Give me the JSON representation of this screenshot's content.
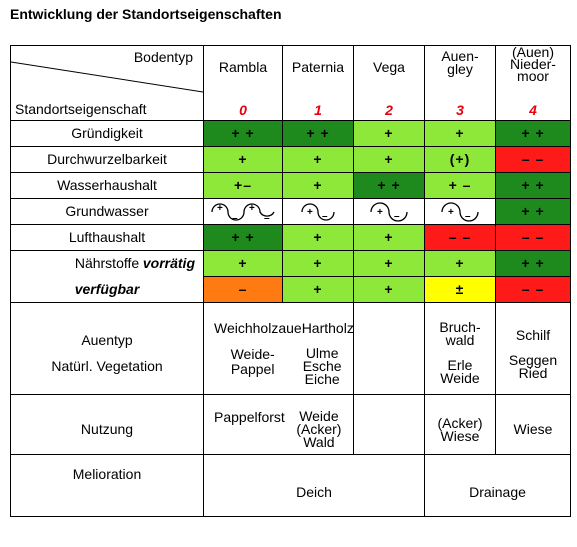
{
  "title": "Entwicklung der Standortseigenschaften",
  "header": {
    "bodentyp": "Bodentyp",
    "standortseigenschaft": "Standortseigenschaft",
    "columns": [
      {
        "name": "Rambla",
        "num": "0"
      },
      {
        "name": "Paternia",
        "num": "1"
      },
      {
        "name": "Vega",
        "num": "2"
      },
      {
        "name": "Auen-\ngley",
        "num": "3"
      },
      {
        "name": "(Auen)\nNieder-\nmoor",
        "num": "4"
      }
    ]
  },
  "rows": [
    {
      "label": "Gründigkeit",
      "cells": [
        "+ +",
        "+ +",
        "+",
        "+",
        "+ +"
      ]
    },
    {
      "label": "Durchwurzelbarkeit",
      "cells": [
        "+",
        "+",
        "+",
        "(+)",
        "– –"
      ]
    },
    {
      "label": "Wasserhaushalt",
      "cells": [
        "+–",
        "+",
        "+ +",
        "+ –",
        "+ +"
      ]
    },
    {
      "label": "Grundwasser",
      "cells": [
        "",
        "",
        "",
        "",
        "+ +"
      ]
    },
    {
      "label": "Lufthaushalt",
      "cells": [
        "+ +",
        "+",
        "+",
        "– –",
        "– –"
      ]
    },
    {
      "label": "Nährstoffe",
      "sub1": "vorrätig",
      "sub2": "verfügbar",
      "cells1": [
        "+",
        "+",
        "+",
        "+",
        "+ +"
      ],
      "cells2": [
        "–",
        "+",
        "+",
        "±",
        "– –"
      ]
    }
  ],
  "colors": {
    "dark_green": "#1e8a1e",
    "light_green": "#8ee83a",
    "red": "#ff1a1a",
    "orange": "#ff7a10",
    "yellow": "#ffff00",
    "number_red": "#e8000f"
  },
  "lower": {
    "auentyp_label": "Auentyp",
    "vegetation_label": "Natürl. Vegetation",
    "auentyp_weich": "Weichholzaue",
    "auentyp_hart": "Hartholzaue",
    "auentyp_bruch": "Bruch-\nwald",
    "auentyp_schilf": "Schilf",
    "veg_weide_pappel": "Weide-Pappel",
    "veg_ulme": "Ulme\nEsche\nEiche",
    "veg_erle": "Erle\nWeide",
    "veg_seggen": "Seggen\nRied",
    "nutzung_label": "Nutzung",
    "nutzung_pappelforst": "Pappelforst",
    "nutzung_weide": "Weide\n(Acker)\nWald",
    "nutzung_acker": "(Acker)\nWiese",
    "nutzung_wiese": "Wiese",
    "melioration_label": "Melioration",
    "melioration_deich": "Deich",
    "melioration_drainage": "Drainage"
  }
}
